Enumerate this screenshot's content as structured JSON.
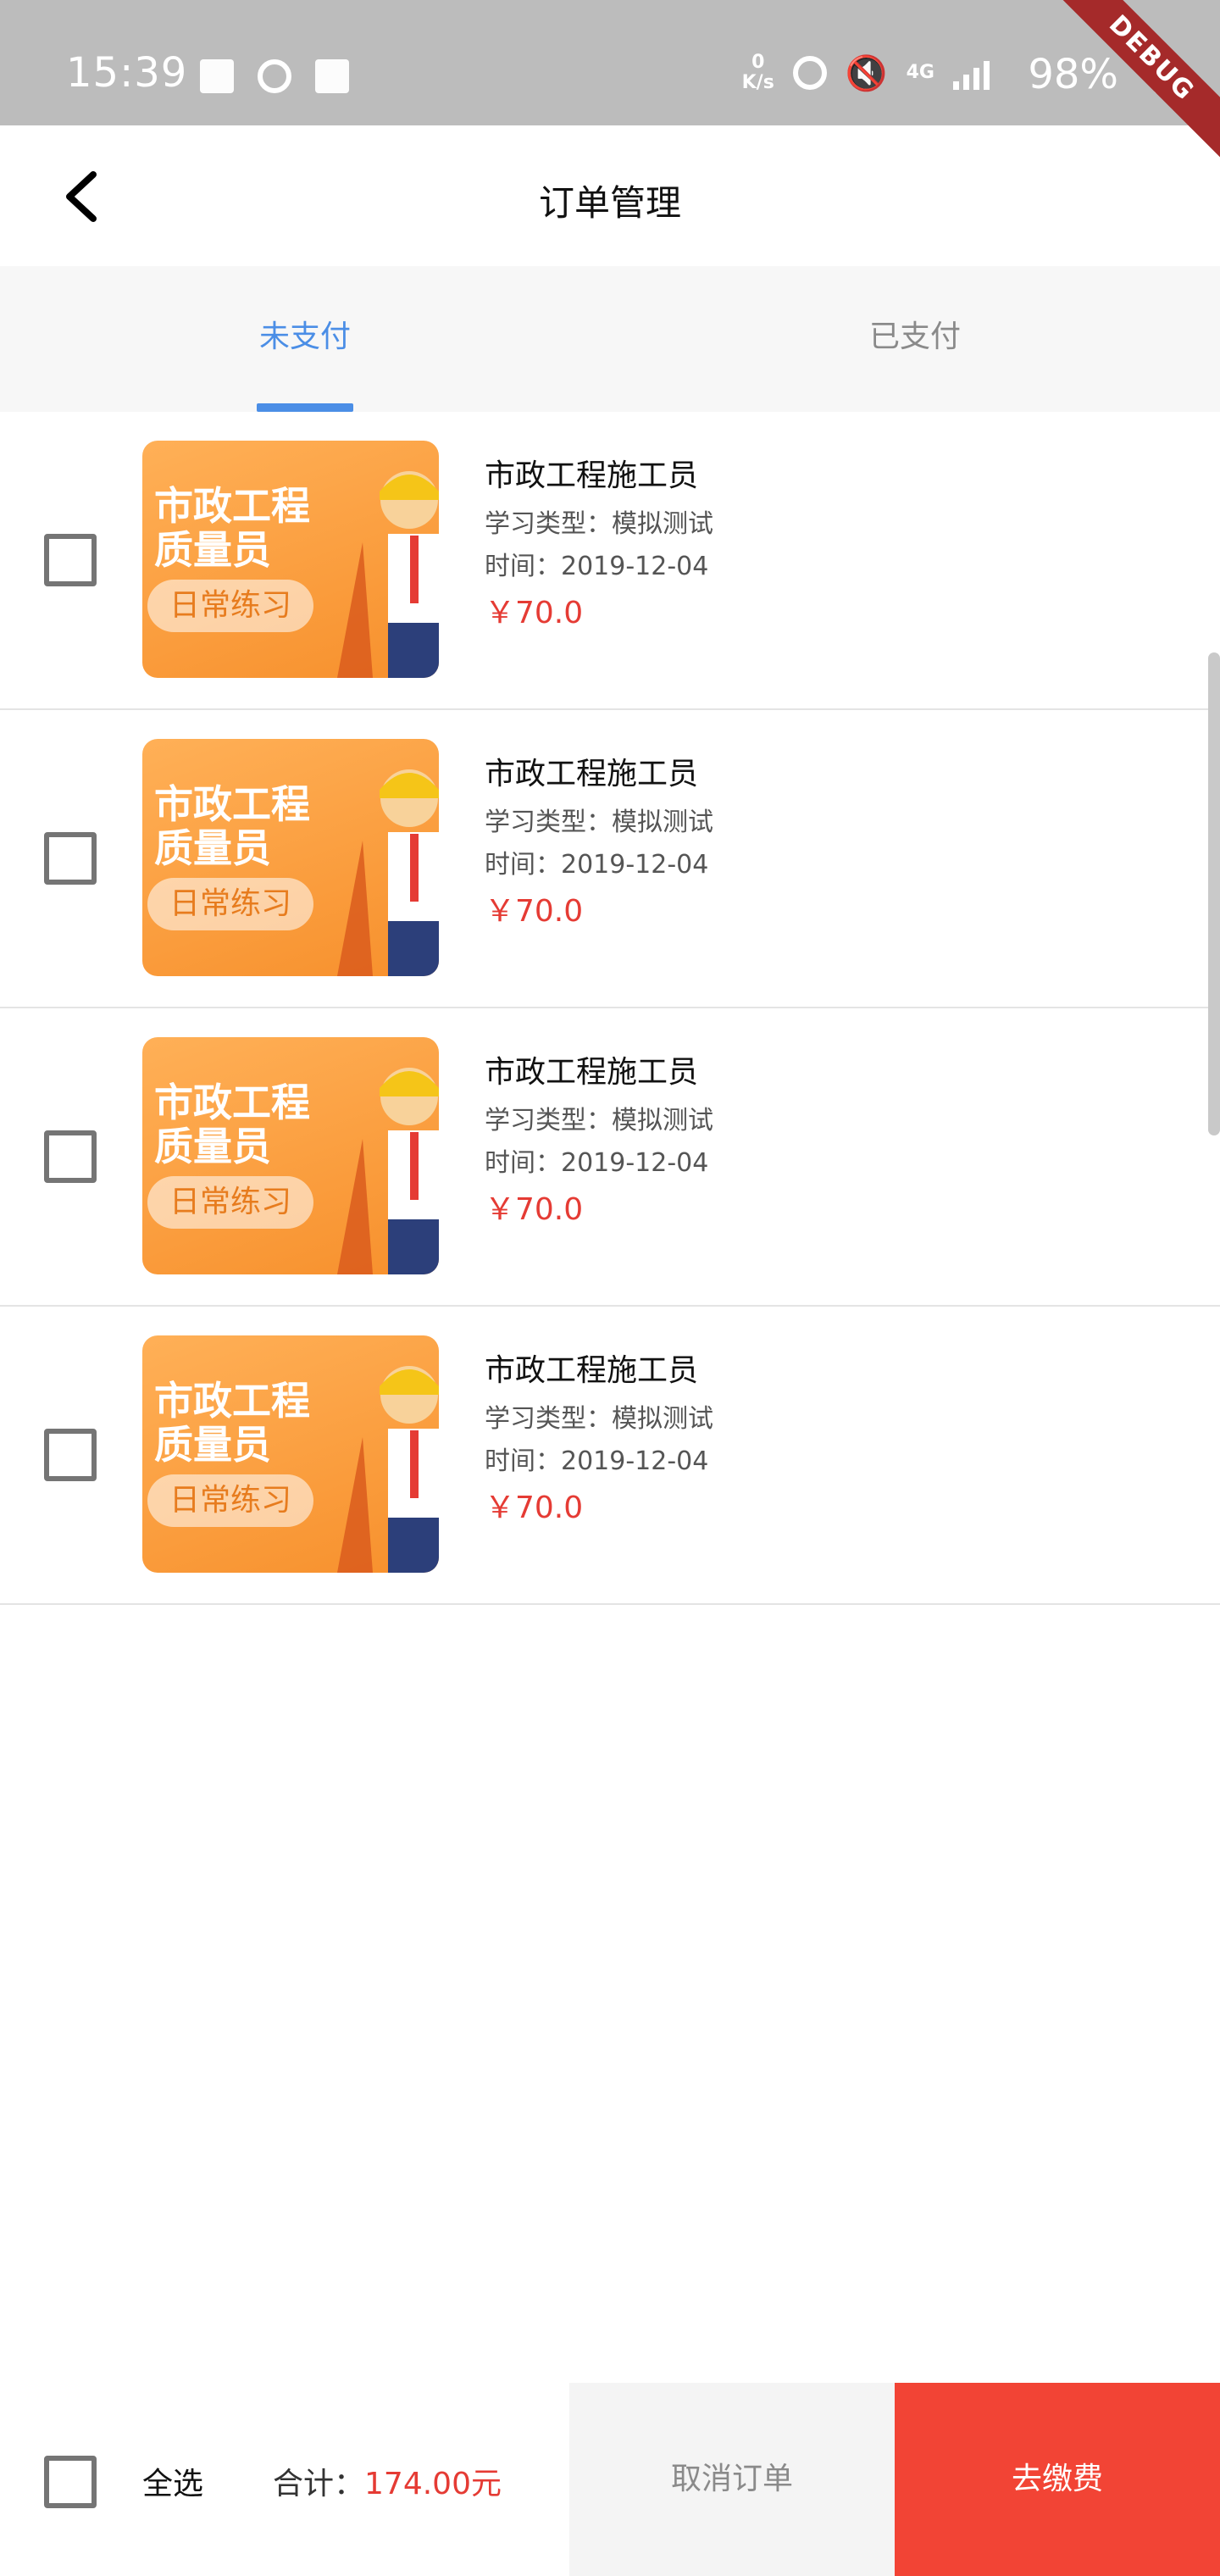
{
  "status_bar": {
    "time": "15:39",
    "network_speed": "0\nK/s",
    "network_type": "4G",
    "battery": "98%"
  },
  "debug_banner": "DEBUG",
  "header": {
    "title": "订单管理"
  },
  "tabs": [
    {
      "label": "未支付",
      "active": true
    },
    {
      "label": "已支付",
      "active": false
    }
  ],
  "orders": [
    {
      "thumb_title_1": "市政工程",
      "thumb_title_2": "质量员",
      "thumb_tag": "日常练习",
      "name": "市政工程施工员",
      "type": "学习类型：模拟测试",
      "time": "时间：2019-12-04",
      "price": "￥70.0",
      "checked": false
    },
    {
      "thumb_title_1": "市政工程",
      "thumb_title_2": "质量员",
      "thumb_tag": "日常练习",
      "name": "市政工程施工员",
      "type": "学习类型：模拟测试",
      "time": "时间：2019-12-04",
      "price": "￥70.0",
      "checked": false
    },
    {
      "thumb_title_1": "市政工程",
      "thumb_title_2": "质量员",
      "thumb_tag": "日常练习",
      "name": "市政工程施工员",
      "type": "学习类型：模拟测试",
      "time": "时间：2019-12-04",
      "price": "￥70.0",
      "checked": false
    },
    {
      "thumb_title_1": "市政工程",
      "thumb_title_2": "质量员",
      "thumb_tag": "日常练习",
      "name": "市政工程施工员",
      "type": "学习类型：模拟测试",
      "time": "时间：2019-12-04",
      "price": "￥70.0",
      "checked": false
    }
  ],
  "bottom_bar": {
    "select_all_label": "全选",
    "total_label": "合计：",
    "total_value": "174.00元",
    "cancel_label": "取消订单",
    "pay_label": "去缴费"
  },
  "colors": {
    "accent": "#4b8ee6",
    "price": "#e53b34",
    "pay_button": "#f24435",
    "thumb": "#f7902c"
  }
}
